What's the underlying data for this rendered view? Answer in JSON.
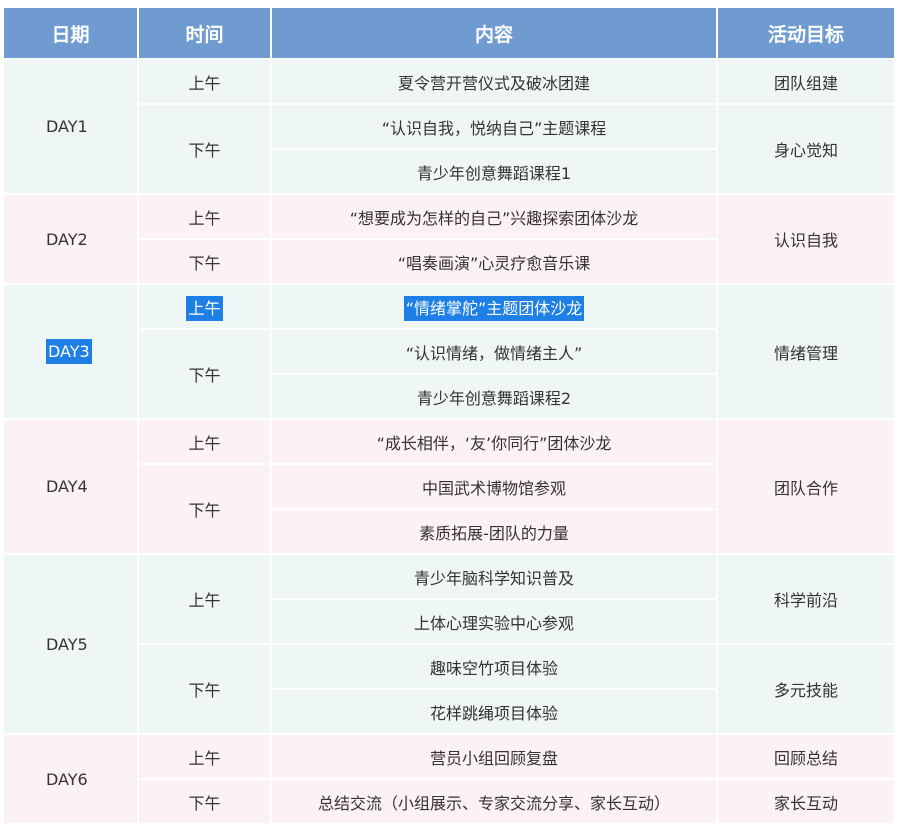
{
  "table": {
    "headers": [
      "日期",
      "时间",
      "内容",
      "活动目标"
    ],
    "days": [
      {
        "day": "DAY1",
        "slots": [
          {
            "time": "上午",
            "items": [
              "夏令营开营仪式及破冰团建"
            ]
          },
          {
            "time": "下午",
            "items": [
              "“认识自我，悦纳自己”主题课程",
              "青少年创意舞蹈课程1"
            ]
          }
        ],
        "goals": [
          "团队组建",
          "身心觉知"
        ]
      },
      {
        "day": "DAY2",
        "slots": [
          {
            "time": "上午",
            "items": [
              "“想要成为怎样的自己”兴趣探索团体沙龙"
            ]
          },
          {
            "time": "下午",
            "items": [
              "“唱奏画演”心灵疗愈音乐课"
            ]
          }
        ],
        "goals": [
          "认识自我"
        ]
      },
      {
        "day": "DAY3",
        "slots": [
          {
            "time": "上午",
            "items": [
              "“情绪掌舵”主题团体沙龙"
            ]
          },
          {
            "time": "下午",
            "items": [
              "“认识情绪，做情绪主人”",
              "青少年创意舞蹈课程2"
            ]
          }
        ],
        "goals": [
          "情绪管理"
        ]
      },
      {
        "day": "DAY4",
        "slots": [
          {
            "time": "上午",
            "items": [
              "“成长相伴，‘友’你同行”团体沙龙"
            ]
          },
          {
            "time": "下午",
            "items": [
              "中国武术博物馆参观",
              "素质拓展-团队的力量"
            ]
          }
        ],
        "goals": [
          "团队合作"
        ]
      },
      {
        "day": "DAY5",
        "slots": [
          {
            "time": "上午",
            "items": [
              "青少年脑科学知识普及",
              "上体心理实验中心参观"
            ]
          },
          {
            "time": "下午",
            "items": [
              "趣味空竹项目体验",
              "花样跳绳项目体验"
            ]
          }
        ],
        "goals": [
          "科学前沿",
          "多元技能"
        ]
      },
      {
        "day": "DAY6",
        "slots": [
          {
            "time": "上午",
            "items": [
              "营员小组回顾复盘"
            ]
          },
          {
            "time": "下午",
            "items": [
              "总结交流（小组展示、专家交流分享、家长互动）"
            ]
          }
        ],
        "goals": [
          "回顾总结",
          "家长互动"
        ]
      }
    ]
  },
  "colors": {
    "header_bg": "#6f9bd1",
    "row_teal": "#eff6f6",
    "row_pink": "#fdf2f3",
    "selection": "#1e7fe6"
  }
}
